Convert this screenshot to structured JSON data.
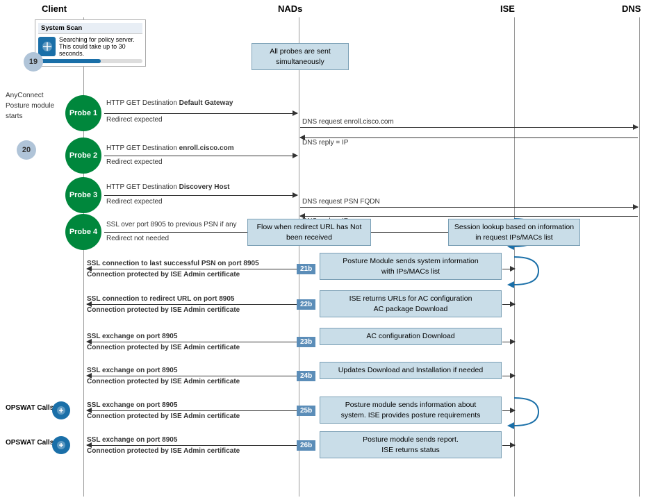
{
  "headers": {
    "client": "Client",
    "nads": "NADs",
    "ise": "ISE",
    "dns": "DNS"
  },
  "scan_box": {
    "title": "System Scan",
    "subtitle": "Searching for policy server.",
    "detail": "This could take up to 30 seconds.",
    "number": "19"
  },
  "anyconnect_label": "AnyConnect\nPosture module\nstarts",
  "probes": [
    {
      "id": "probe1",
      "label": "Probe 1"
    },
    {
      "id": "probe2",
      "label": "Probe 2"
    },
    {
      "id": "probe3",
      "label": "Probe 3"
    },
    {
      "id": "probe4",
      "label": "Probe 4"
    }
  ],
  "probe_arrows": [
    {
      "id": "p1a",
      "label": "HTTP GET Destination",
      "bold": "Default Gateway",
      "sub": "Redirect expected"
    },
    {
      "id": "p2a",
      "label": "HTTP GET Destination",
      "bold": "enroll.cisco.com",
      "sub": "Redirect expected"
    },
    {
      "id": "p3a",
      "label": "HTTP GET Destination",
      "bold": "Discovery Host",
      "sub": "Redirect expected"
    },
    {
      "id": "p4a",
      "label": "SSL over port 8905 to previous PSN if any",
      "sub": "Redirect not needed"
    }
  ],
  "dns_arrows": [
    {
      "label": "DNS request enroll.cisco.com"
    },
    {
      "label": "DNS reply = IP"
    },
    {
      "label": "DNS request PSN FQDN"
    },
    {
      "label": "DNS reply = IP"
    }
  ],
  "probes_box": {
    "text": "All probes are sent\nsimultaneously"
  },
  "flow_box": {
    "text": "Flow when  redirect URL\nhas Not been received"
  },
  "session_box": {
    "text": "Session lookup based on\ninformation in request IPs/MACs list"
  },
  "num20": "20",
  "steps": [
    {
      "id": "21b",
      "label": "21b",
      "arrow_left": "SSL connection to last successful PSN  on port 8905",
      "arrow_left2": "Connection  protected by ISE Admin certificate",
      "box_text": "Posture Module sends system information\nwith IPs/MACs list"
    },
    {
      "id": "22b",
      "label": "22b",
      "arrow_left": "SSL connection to redirect URL on port 8905",
      "arrow_left2": "Connection  protected by ISE Admin certificate",
      "box_text": "ISE returns URLs for AC configuration\nAC package Download"
    },
    {
      "id": "23b",
      "label": "23b",
      "arrow_left": "SSL exchange on port 8905",
      "arrow_left2": "Connection  protected by ISE Admin certificate",
      "box_text": "AC configuration Download"
    },
    {
      "id": "24b",
      "label": "24b",
      "arrow_left": "SSL exchange on port 8905",
      "arrow_left2": "Connection  protected by ISE Admin certificate",
      "box_text": "Updates Download and Installation if needed"
    },
    {
      "id": "25b",
      "label": "25b",
      "arrow_left": "SSL exchange on port 8905",
      "arrow_left2": "Connection  protected by ISE Admin certificate",
      "box_text": "Posture module sends information about\nsystem. ISE provides posture requirements",
      "opswat": "OPSWAT Calls"
    },
    {
      "id": "26b",
      "label": "26b",
      "arrow_left": "SSL exchange on port 8905",
      "arrow_left2": "Connection  protected by ISE Admin certificate",
      "box_text": "Posture module sends report.\nISE returns status",
      "opswat": "OPSWAT Calls"
    }
  ]
}
